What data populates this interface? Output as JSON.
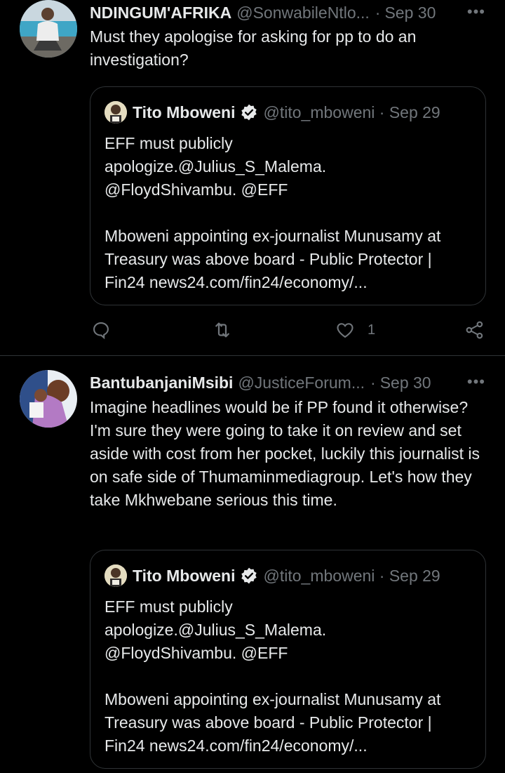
{
  "tweets": [
    {
      "author": "NDINGUM'AFRIKA",
      "handle": "@SonwabileNtlo...",
      "date": "Sep 30",
      "more": "•••",
      "text": "Must they apologise for asking for pp to do an investigation?",
      "quote": {
        "author": "Tito Mboweni",
        "handle": "@tito_mboweni · Sep 29",
        "text": "EFF must publicly\napologize.@Julius_S_Malema.\n@FloydShivambu. @EFF\n\nMboweni appointing ex-journalist Munusamy at Treasury was above board - Public Protector | Fin24 news24.com/fin24/economy/..."
      },
      "like_count": "1"
    },
    {
      "author": "BantubanjaniMsibi",
      "handle": "@JusticeForum...",
      "date": "Sep 30",
      "more": "•••",
      "text": "Imagine headlines would be if PP found it otherwise?\nI'm sure they were going to take it on review and set aside with cost from her pocket, luckily this journalist is on safe side of Thumaminmediagroup. Let's how they take Mkhwebane serious this time.",
      "quote": {
        "author": "Tito Mboweni",
        "handle": "@tito_mboweni · Sep 29",
        "text": "EFF must publicly\napologize.@Julius_S_Malema.\n@FloydShivambu. @EFF\n\nMboweni appointing ex-journalist Munusamy at Treasury was above board - Public Protector | Fin24 news24.com/fin24/economy/..."
      }
    }
  ],
  "icons": {
    "reply": "reply-icon",
    "retweet": "retweet-icon",
    "like": "heart-icon",
    "share": "share-icon",
    "verified": "verified-badge-icon"
  },
  "colors": {
    "background": "#000000",
    "text": "#e7e9ea",
    "muted": "#71767b",
    "border": "#2f3336"
  }
}
